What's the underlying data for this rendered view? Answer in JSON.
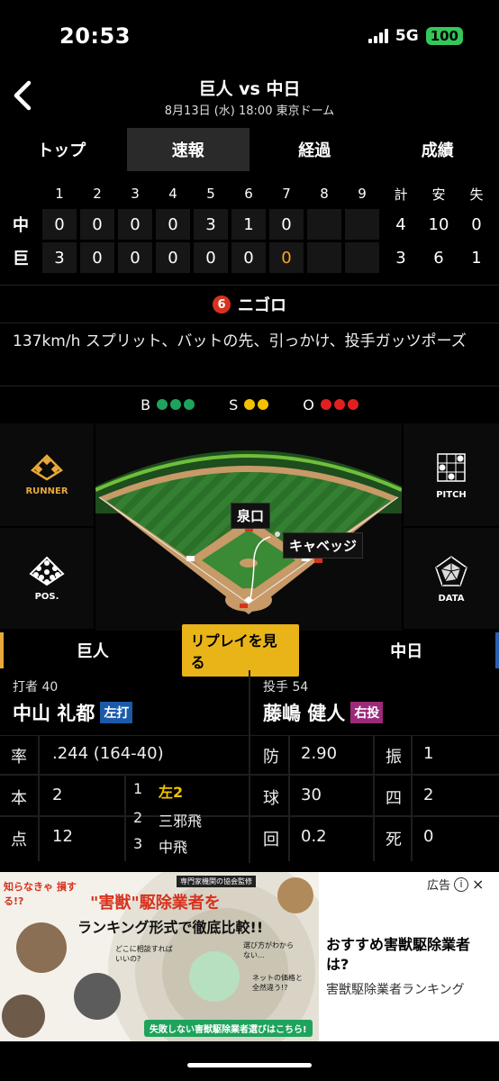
{
  "status": {
    "time": "20:53",
    "network": "5G",
    "battery": "100"
  },
  "header": {
    "title": "巨人 vs 中日",
    "subtitle": "8月13日 (水) 18:00 東京ドーム"
  },
  "tabs": [
    {
      "label": "トップ",
      "active": false
    },
    {
      "label": "速報",
      "active": true
    },
    {
      "label": "経過",
      "active": false
    },
    {
      "label": "成績",
      "active": false
    }
  ],
  "scoreboard": {
    "headers": [
      "1",
      "2",
      "3",
      "4",
      "5",
      "6",
      "7",
      "8",
      "9",
      "計",
      "安",
      "失"
    ],
    "rows": [
      {
        "team": "中",
        "innings": [
          "0",
          "0",
          "0",
          "0",
          "3",
          "1",
          "0",
          "",
          ""
        ],
        "totals": [
          "4",
          "10",
          "0"
        ]
      },
      {
        "team": "巨",
        "innings": [
          "3",
          "0",
          "0",
          "0",
          "0",
          "0",
          "0",
          "",
          ""
        ],
        "totals": [
          "3",
          "6",
          "1"
        ]
      }
    ],
    "highlight_color": "#f5a623"
  },
  "play": {
    "position_number": "6",
    "result": "ニゴロ",
    "description": "137km/h スプリット、バットの先、引っかけ、投手ガッツポーズ"
  },
  "count": {
    "b": {
      "label": "B",
      "colors": [
        "#1fa35c",
        "#1fa35c",
        "#1fa35c"
      ]
    },
    "s": {
      "label": "S",
      "colors": [
        "#f2c200",
        "#f2c200"
      ]
    },
    "o": {
      "label": "O",
      "colors": [
        "#e02020",
        "#e02020",
        "#e02020"
      ]
    }
  },
  "side_buttons": {
    "runner": "RUNNER",
    "pos": "POS.",
    "pitch": "PITCH",
    "data": "DATA"
  },
  "field_labels": {
    "fielder": "泉口",
    "runner_name": "キャベッジ"
  },
  "teambar": {
    "home": "巨人",
    "replay": "リプレイを見る",
    "away": "中日"
  },
  "batter": {
    "label": "打者 40",
    "name": "中山 礼都",
    "hand": "左打",
    "stats": [
      {
        "k": "率",
        "v": ".244 (164-40)"
      },
      {
        "k": "本",
        "v": "2"
      },
      {
        "k": "点",
        "v": "12"
      }
    ],
    "at_bats": [
      {
        "n": "1",
        "r": "左2",
        "hit": true
      },
      {
        "n": "2",
        "r": "三邪飛",
        "hit": false
      },
      {
        "n": "3",
        "r": "中飛",
        "hit": false
      }
    ]
  },
  "pitcher": {
    "label": "投手 54",
    "name": "藤嶋 健人",
    "hand": "右投",
    "stats": [
      {
        "k": "防",
        "v": "2.90",
        "k2": "振",
        "v2": "1"
      },
      {
        "k": "球",
        "v": "30",
        "k2": "四",
        "v2": "2"
      },
      {
        "k": "回",
        "v": "0.2",
        "k2": "死",
        "v2": "0"
      }
    ]
  },
  "ad": {
    "badge": "広告",
    "creative_top": "知らなきゃ 損する!?",
    "creative_headline_1": "\"害獣\"駆除業者を",
    "creative_headline_2": "ランキング形式で徹底比較!!",
    "creative_supervised": "専門家機関の協会監修",
    "creative_bubble_1": "どこに相談すればいいの?",
    "creative_bubble_2": "選び方がわからない…",
    "creative_bubble_3": "ネットの価格と全然違う!?",
    "creative_footer": "失敗しない害獣駆除業者選びはこちら!",
    "title": "おすすめ害獣駆除業者は?",
    "subtitle": "害獣駆除業者ランキング"
  }
}
